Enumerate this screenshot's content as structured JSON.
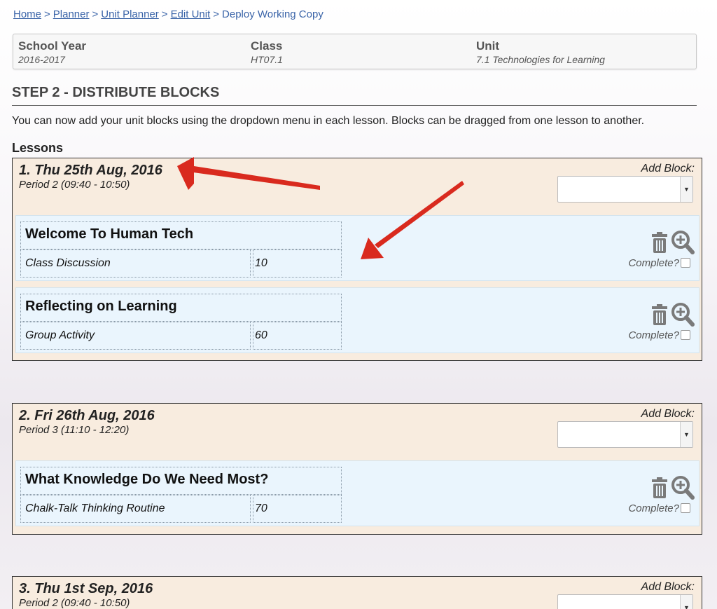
{
  "breadcrumb": {
    "home": "Home",
    "planner": "Planner",
    "unit_planner": "Unit Planner",
    "edit_unit": "Edit Unit",
    "current": "Deploy Working Copy",
    "separator": ">"
  },
  "info": {
    "school_year_label": "School Year",
    "school_year_value": "2016-2017",
    "class_label": "Class",
    "class_value": "HT07.1",
    "unit_label": "Unit",
    "unit_value": "7.1 Technologies for Learning"
  },
  "step_title": "STEP 2 - DISTRIBUTE BLOCKS",
  "intro": "You can now add your unit blocks using the dropdown menu in each lesson. Blocks can be dragged from one lesson to another.",
  "lessons_heading": "Lessons",
  "add_block_label": "Add Block:",
  "complete_label": "Complete?",
  "icons": {
    "trash": "trash-icon",
    "zoom": "zoom-in-icon",
    "dropdown": "chevron-down-icon"
  },
  "colors": {
    "lesson_bg": "#f8ecdf",
    "block_bg": "#eaf5fd",
    "link": "#3a64a8",
    "annotation_arrow": "#d92a1e"
  },
  "lessons": [
    {
      "title": "1. Thu 25th Aug, 2016",
      "period": "Period 2 (09:40 - 10:50)",
      "blocks": [
        {
          "title": "Welcome To Human Tech",
          "activity": "Class Discussion",
          "minutes": "10"
        },
        {
          "title": "Reflecting on Learning",
          "activity": "Group Activity",
          "minutes": "60"
        }
      ]
    },
    {
      "title": "2. Fri 26th Aug, 2016",
      "period": "Period 3 (11:10 - 12:20)",
      "blocks": [
        {
          "title": "What Knowledge Do We Need Most?",
          "activity": "Chalk-Talk Thinking Routine",
          "minutes": "70"
        }
      ]
    },
    {
      "title": "3. Thu 1st Sep, 2016",
      "period": "Period 2 (09:40 - 10:50)",
      "blocks": []
    }
  ]
}
